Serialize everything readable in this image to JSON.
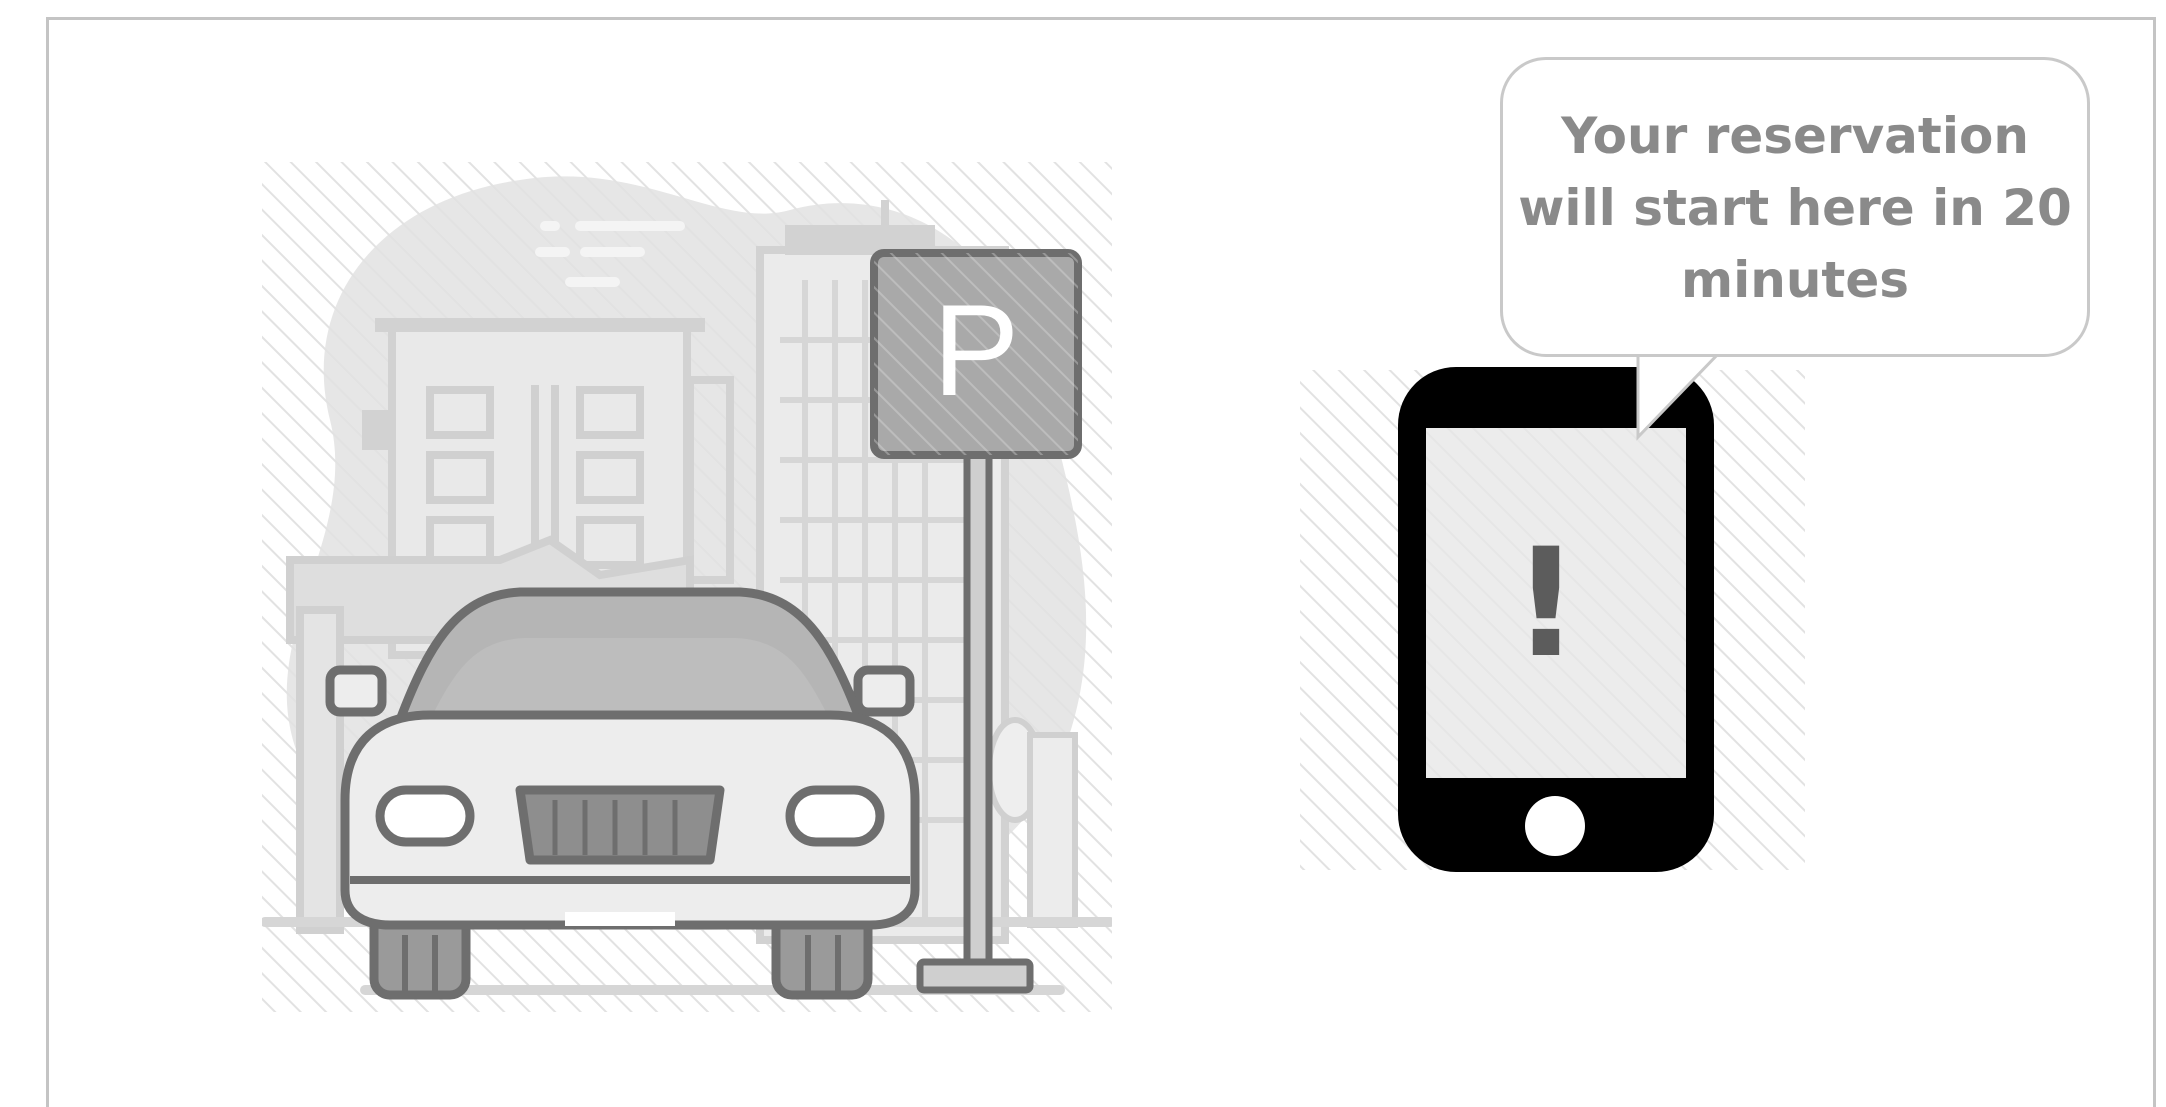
{
  "notification": {
    "message": "Your reservation will start here in 20 minutes"
  },
  "illustration": {
    "parking_sign_letter": "P",
    "phone_alert_glyph": "!"
  },
  "colors": {
    "frame_border": "#c4c4c4",
    "illustration_gray": "#6e6e6e",
    "light_gray": "#d9d9d9",
    "bubble_text": "#8a8a8a",
    "phone_body": "#000000"
  },
  "icons": [
    "parking-scene-illustration",
    "parking-sign-icon",
    "car-icon",
    "smartphone-alert-icon"
  ]
}
